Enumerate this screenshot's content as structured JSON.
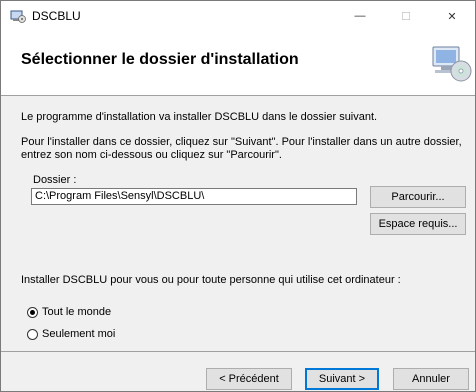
{
  "window": {
    "title": "DSCBLU",
    "minimize_glyph": "—",
    "maximize_glyph": "☐",
    "close_glyph": "✕"
  },
  "header": {
    "title": "Sélectionner le dossier d'installation",
    "graphic_icon": "computer-cd-icon"
  },
  "body": {
    "intro": "Le programme d'installation va installer DSCBLU dans le dossier suivant.",
    "instructions_line1": "Pour l'installer dans ce dossier, cliquez sur \"Suivant\". Pour l'installer dans un autre dossier,",
    "instructions_line2": "entrez son nom ci-dessous ou cliquez sur \"Parcourir\".",
    "folder_label": "Dossier :",
    "folder_value": "C:\\Program Files\\Sensyl\\DSCBLU\\",
    "browse_button": "Parcourir...",
    "disk_space_button": "Espace requis...",
    "install_for_question": "Installer DSCBLU pour vous ou pour toute personne qui utilise cet ordinateur :",
    "options": [
      {
        "label": "Tout le monde",
        "selected": true
      },
      {
        "label": "Seulement moi",
        "selected": false
      }
    ]
  },
  "footer": {
    "back_button": "< Précédent",
    "next_button": "Suivant >",
    "cancel_button": "Annuler"
  },
  "colors": {
    "default_button_border": "#0078d7",
    "dialog_background": "#f0f0f0"
  }
}
